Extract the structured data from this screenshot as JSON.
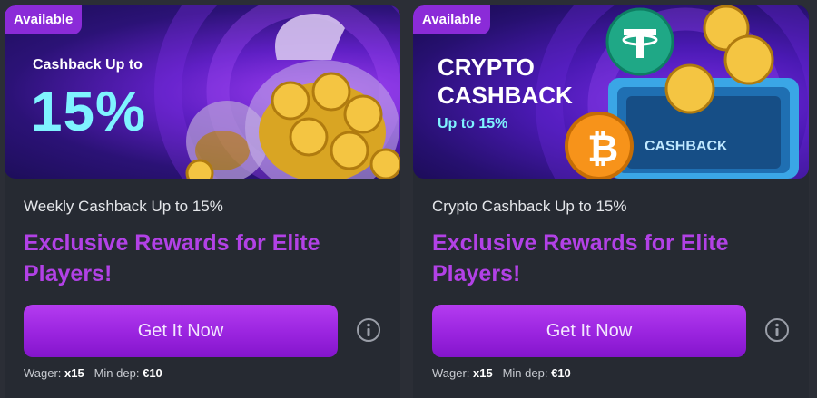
{
  "cards": [
    {
      "badge": "Available",
      "banner_line1": "Cashback Up to",
      "banner_big": "15%",
      "subtitle": "Weekly Cashback Up to 15%",
      "headline": "Exclusive Rewards for Elite Players!",
      "button_label": "Get It Now",
      "wager_label": "Wager:",
      "wager_value": "x15",
      "min_dep_label": "Min dep:",
      "min_dep_value": "€10"
    },
    {
      "badge": "Available",
      "banner_title_1": "CRYPTO",
      "banner_title_2": "CASHBACK",
      "banner_sub": "Up to 15%",
      "safe_label": "CASHBACK",
      "subtitle": "Crypto Cashback Up to 15%",
      "headline": "Exclusive Rewards for Elite Players!",
      "button_label": "Get It Now",
      "wager_label": "Wager:",
      "wager_value": "x15",
      "min_dep_label": "Min dep:",
      "min_dep_value": "€10"
    }
  ],
  "colors": {
    "accent_purple": "#9a24df",
    "headline_purple": "#b241e6",
    "cyan": "#7ff3ff",
    "card_bg": "#262a32"
  },
  "icons": [
    "money-bag-icon",
    "gold-coin-icon",
    "bitcoin-icon",
    "tether-icon",
    "safe-icon",
    "info-icon"
  ]
}
